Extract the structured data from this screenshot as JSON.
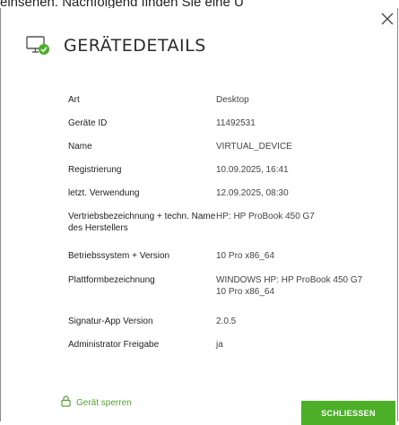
{
  "background_text": "einsehen. Nachfolgend finden Sie eine Ü",
  "dialog": {
    "title": "GERÄTEDETAILS",
    "rows": [
      {
        "label": "Art",
        "value": "Desktop"
      },
      {
        "label": "Geräte ID",
        "value": "11492531"
      },
      {
        "label": "Name",
        "value": "VIRTUAL_DEVICE"
      },
      {
        "label": "Registrierung",
        "value": "10.09.2025, 16:41"
      },
      {
        "label": "letzt. Verwendung",
        "value": "12.09.2025, 08:30"
      },
      {
        "label": "Vertriebsbezeichnung + techn. Name des Herstellers",
        "value": "HP: HP ProBook 450 G7"
      },
      {
        "label": "Betriebssystem + Version",
        "value": "10 Pro x86_64"
      },
      {
        "label": "Plattformbezeichnung",
        "value": "WINDOWS HP: HP ProBook 450 G7 10 Pro x86_64"
      },
      {
        "label": "Signatur-App Version",
        "value": "2.0.5"
      },
      {
        "label": "Administrator Freigabe",
        "value": "ja"
      }
    ],
    "lock_link": "Gerät sperren",
    "close_button": "SCHLIESSEN"
  },
  "icons": {
    "header": "device-check-icon",
    "close": "close-icon",
    "lock": "lock-icon"
  },
  "colors": {
    "accent": "#4caf27",
    "link": "#54a32f"
  }
}
